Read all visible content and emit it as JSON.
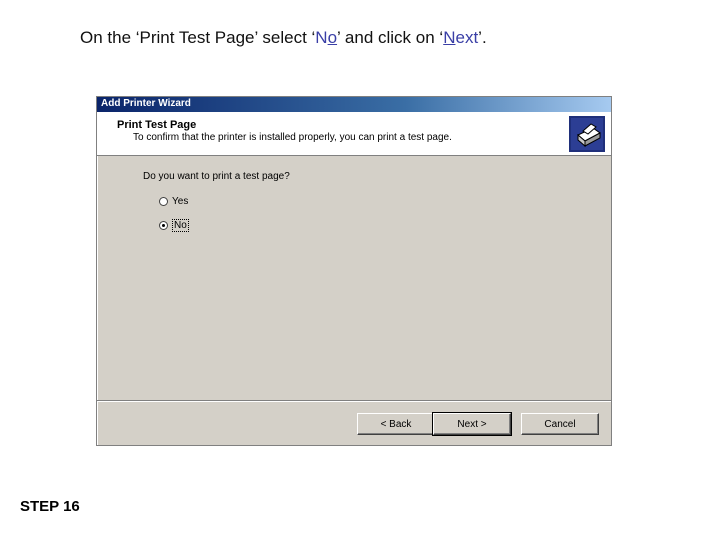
{
  "instruction": {
    "prefix": "On the ‘Print Test Page’ select ‘",
    "no_first": "N",
    "no_underlined": "o",
    "middle": "’ and click on ‘",
    "next_underlined": "N",
    "next_rest": "ext",
    "suffix": "’."
  },
  "step_label": "STEP 16",
  "dialog": {
    "title": "Add Printer Wizard",
    "header_title": "Print Test Page",
    "header_subtitle": "To confirm that the printer is installed properly, you can print a test page.",
    "question": "Do you want to print a test page?",
    "options": [
      {
        "label": "Yes",
        "checked": false
      },
      {
        "label": "No",
        "checked": true
      }
    ],
    "buttons": {
      "back": "< Back",
      "next": "Next >",
      "cancel": "Cancel"
    }
  },
  "colors": {
    "titlebar": "#0a246a",
    "dialog_bg": "#d4d0c8",
    "instruction_highlight": "#3a3fa6"
  }
}
